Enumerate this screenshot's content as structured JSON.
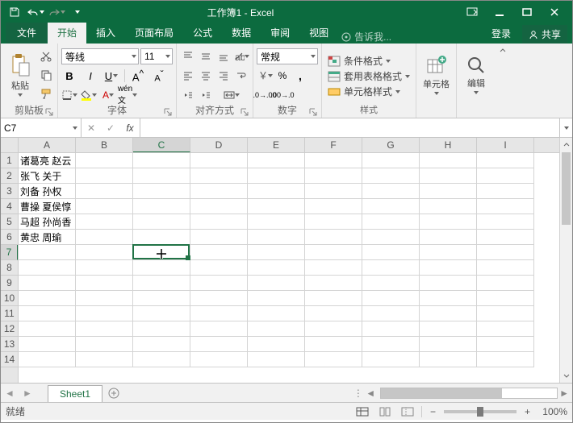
{
  "title": "工作簿1 - Excel",
  "tabs": {
    "file": "文件",
    "home": "开始",
    "insert": "插入",
    "layout": "页面布局",
    "formulas": "公式",
    "data": "数据",
    "review": "审阅",
    "view": "视图",
    "tellme": "告诉我...",
    "login": "登录",
    "share": "共享"
  },
  "ribbon": {
    "clipboard": {
      "paste": "粘贴",
      "label": "剪贴板"
    },
    "font": {
      "name": "等线",
      "size": "11",
      "label": "字体"
    },
    "align": {
      "label": "对齐方式"
    },
    "number": {
      "format": "常规",
      "label": "数字"
    },
    "styles": {
      "cond": "条件格式",
      "table": "套用表格格式",
      "cell": "单元格样式",
      "label": "样式"
    },
    "cells": {
      "label": "单元格"
    },
    "editing": {
      "label": "编辑"
    }
  },
  "namebox": "C7",
  "columns": [
    "A",
    "B",
    "C",
    "D",
    "E",
    "F",
    "G",
    "H",
    "I"
  ],
  "rows": [
    "1",
    "2",
    "3",
    "4",
    "5",
    "6",
    "7",
    "8",
    "9",
    "10",
    "11",
    "12",
    "13",
    "14"
  ],
  "cell_data": {
    "A1": "诸葛亮 赵云",
    "A2": "张飞 关于",
    "A3": "刘备 孙权",
    "A4": "曹操 夏侯惇",
    "A5": "马超 孙尚香",
    "A6": "黄忠 周瑜"
  },
  "active_cell": {
    "col": 2,
    "row": 6
  },
  "sheet": "Sheet1",
  "status": "就绪",
  "zoom": "100%"
}
